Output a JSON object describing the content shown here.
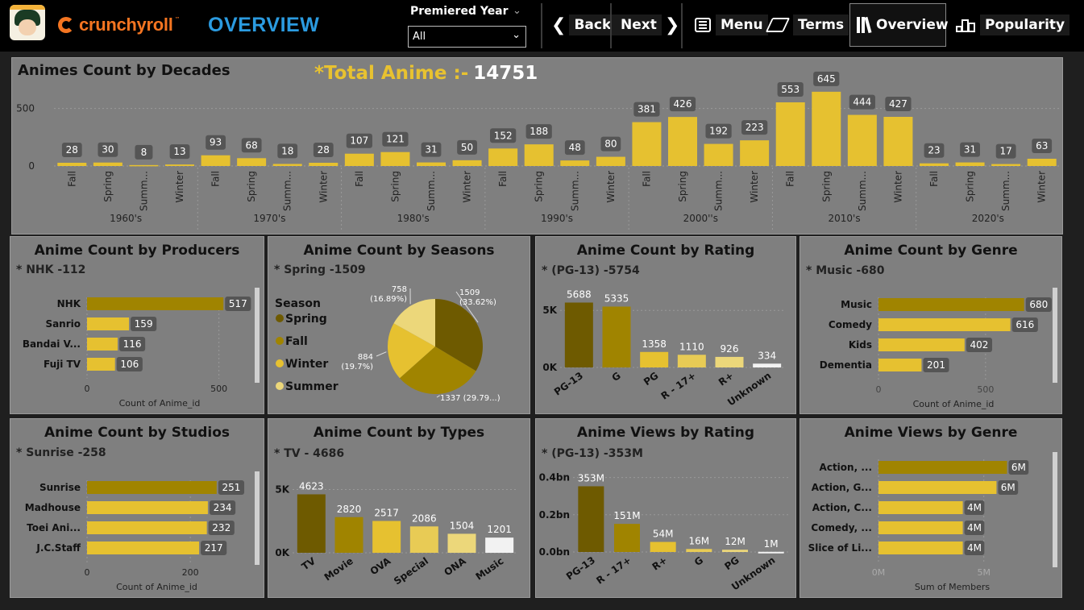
{
  "header": {
    "brand": "crunchyroll",
    "brand_tm": "™",
    "page_title": "OVERVIEW",
    "slicer_label": "Premiered Year",
    "slicer_value": "All",
    "nav": {
      "back": "Back",
      "next": "Next",
      "menu": "Menu",
      "terms": "Terms",
      "overview": "Overview",
      "popularity": "Popularity"
    }
  },
  "colors": {
    "background": "#7f7f7f",
    "gold": "#e6c130",
    "dark_gold": "#a08400",
    "darkest_gold": "#6e5a00",
    "light_gold": "#ecd77a",
    "pale_gold": "#f0e2a8",
    "brand_orange": "#f47521",
    "title_blue": "#2b9be0"
  },
  "decades": {
    "title": "Animes Count by Decades",
    "total_label": "*Total Anime :-",
    "total_value": "14751",
    "chart_data": {
      "type": "bar",
      "ylim": [
        0,
        700
      ],
      "yticks": [
        0,
        500
      ],
      "decades": [
        "1960's",
        "1970's",
        "1980's",
        "1990's",
        "2000''s",
        "2010's",
        "2020's"
      ],
      "seasons": [
        "Fall",
        "Spring",
        "Summ...",
        "Winter"
      ],
      "values": [
        [
          28,
          30,
          8,
          13
        ],
        [
          93,
          68,
          18,
          28
        ],
        [
          107,
          121,
          31,
          50
        ],
        [
          152,
          188,
          48,
          80
        ],
        [
          381,
          426,
          192,
          223
        ],
        [
          553,
          645,
          444,
          427
        ],
        [
          23,
          31,
          17,
          63
        ]
      ]
    }
  },
  "producers": {
    "title": "Anime Count by Producers",
    "subtitle": "* NHK -112",
    "chart_data": {
      "type": "bar",
      "orientation": "horizontal",
      "categories": [
        "NHK",
        "Sanrio",
        "Bandai V...",
        "Fuji TV"
      ],
      "values": [
        517,
        159,
        116,
        106
      ],
      "xlim": [
        0,
        550
      ],
      "xticks": [
        0,
        500
      ],
      "xlabel": "Count of Anime_id"
    }
  },
  "seasons": {
    "title": "Anime Count by Seasons",
    "subtitle": "* Spring -1509",
    "chart_data": {
      "type": "pie",
      "legend_title": "Season",
      "categories": [
        "Spring",
        "Fall",
        "Winter",
        "Summer"
      ],
      "values": [
        1509,
        1337,
        884,
        758
      ],
      "labels": [
        "1509\n(33.62%)",
        "1337 (29.79...)",
        "884\n(19.7%)",
        "758\n(16.89%)"
      ]
    }
  },
  "rating_count": {
    "title": "Anime Count by Rating",
    "subtitle": "* (PG-13) -5754",
    "chart_data": {
      "type": "bar",
      "categories": [
        "PG-13",
        "G",
        "PG",
        "R - 17+",
        "R+",
        "Unknown"
      ],
      "values": [
        5688,
        5335,
        1358,
        1110,
        926,
        334
      ],
      "ylim": [
        0,
        6500
      ],
      "yticks": [
        "0K",
        "5K"
      ]
    }
  },
  "genre_count": {
    "title": "Anime Count by Genre",
    "subtitle": "* Music -680",
    "chart_data": {
      "type": "bar",
      "orientation": "horizontal",
      "categories": [
        "Music",
        "Comedy",
        "Kids",
        "Dementia"
      ],
      "values": [
        680,
        616,
        402,
        201
      ],
      "xlim": [
        0,
        700
      ],
      "xticks": [
        0,
        500
      ],
      "xlabel": "Count of Anime_id"
    }
  },
  "studios": {
    "title": "Anime Count by Studios",
    "subtitle": "* Sunrise -258",
    "chart_data": {
      "type": "bar",
      "orientation": "horizontal",
      "categories": [
        "Sunrise",
        "Madhouse",
        "Toei Ani...",
        "J.C.Staff"
      ],
      "values": [
        251,
        234,
        232,
        217
      ],
      "xlim": [
        0,
        270
      ],
      "xticks": [
        0,
        200
      ],
      "xlabel": "Count of Anime_id"
    }
  },
  "types": {
    "title": "Anime Count by Types",
    "subtitle": "* TV - 4686",
    "chart_data": {
      "type": "bar",
      "categories": [
        "TV",
        "Movie",
        "OVA",
        "Special",
        "ONA",
        "Music"
      ],
      "values": [
        4623,
        2820,
        2517,
        2086,
        1504,
        1201
      ],
      "ylim": [
        0,
        5800
      ],
      "yticks": [
        "0K",
        "5K"
      ]
    }
  },
  "rating_views": {
    "title": "Anime Views by Rating",
    "subtitle": "* (PG-13) -353M",
    "chart_data": {
      "type": "bar",
      "categories": [
        "PG-13",
        "R - 17+",
        "R+",
        "G",
        "PG",
        "Unknown"
      ],
      "values": [
        353,
        151,
        54,
        16,
        12,
        1
      ],
      "value_labels": [
        "353M",
        "151M",
        "54M",
        "16M",
        "12M",
        "1M"
      ],
      "ylim": [
        0,
        420
      ],
      "yticks": [
        "0.0bn",
        "0.2bn",
        "0.4bn"
      ]
    }
  },
  "genre_views": {
    "title": "Anime Views by Genre",
    "chart_data": {
      "type": "bar",
      "orientation": "horizontal",
      "categories": [
        "Action, ...",
        "Action, G...",
        "Action, C...",
        "Comedy, ...",
        "Slice of Li..."
      ],
      "values": [
        6.1,
        5.6,
        4.0,
        4.0,
        4.0
      ],
      "value_labels": [
        "6M",
        "6M",
        "4M",
        "4M",
        "4M"
      ],
      "xlim": [
        0,
        7
      ],
      "xticks": [
        "0M",
        "5M"
      ],
      "xlabel": "Sum of Members"
    }
  }
}
